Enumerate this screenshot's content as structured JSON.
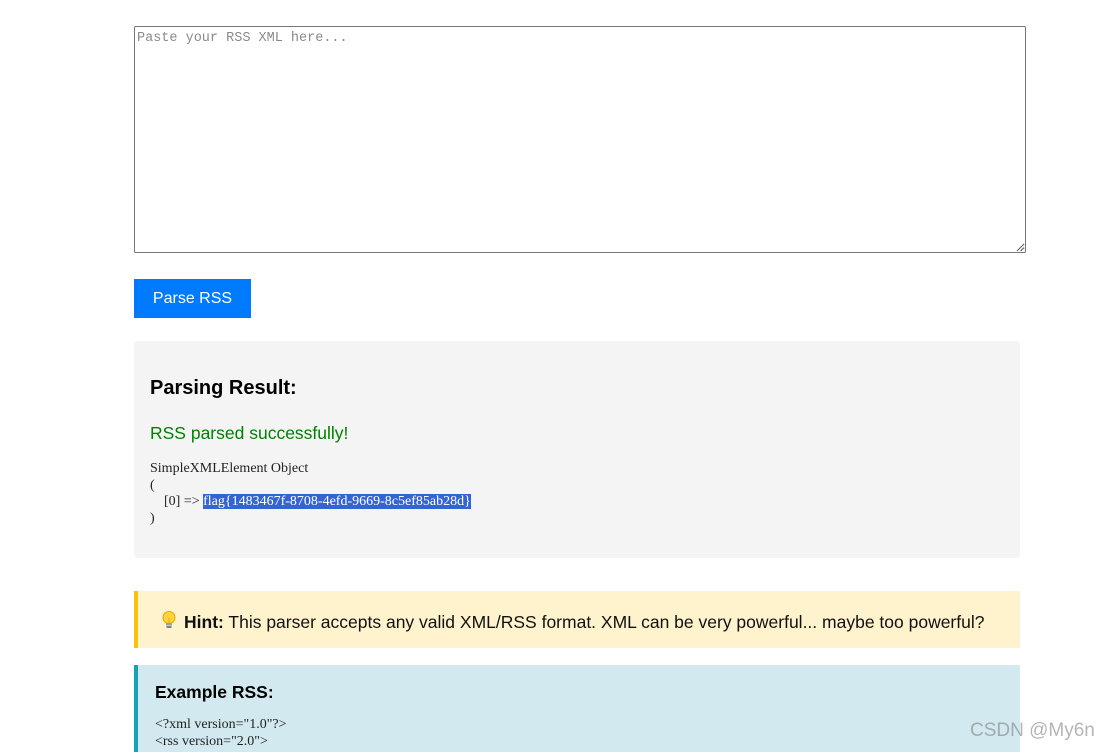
{
  "input": {
    "placeholder": "Paste your RSS XML here...",
    "value": ""
  },
  "parse_button": {
    "label": "Parse RSS"
  },
  "result": {
    "title": "Parsing Result:",
    "status": "RSS parsed successfully!",
    "status_color": "#008000",
    "lines": {
      "line1": "SimpleXMLElement Object",
      "line2": "(",
      "line3_prefix": "    [0] => ",
      "line3_value": "flag{1483467f-8708-4efd-9669-8c5ef85ab28d}",
      "line4": ")"
    }
  },
  "hint": {
    "icon": "lightbulb-icon",
    "label": "Hint:",
    "text": " This parser accepts any valid XML/RSS format. XML can be very powerful... maybe too powerful?"
  },
  "example": {
    "title": "Example RSS:",
    "code": "<?xml version=\"1.0\"?>\n<rss version=\"2.0\">"
  },
  "watermark": "CSDN @My6n",
  "colors": {
    "button": "#007bff",
    "hint_bg": "#fff3cd",
    "hint_border": "#ffc107",
    "example_bg": "#d1e9ef",
    "example_border": "#17a2b8",
    "selection": "#3464d3"
  }
}
